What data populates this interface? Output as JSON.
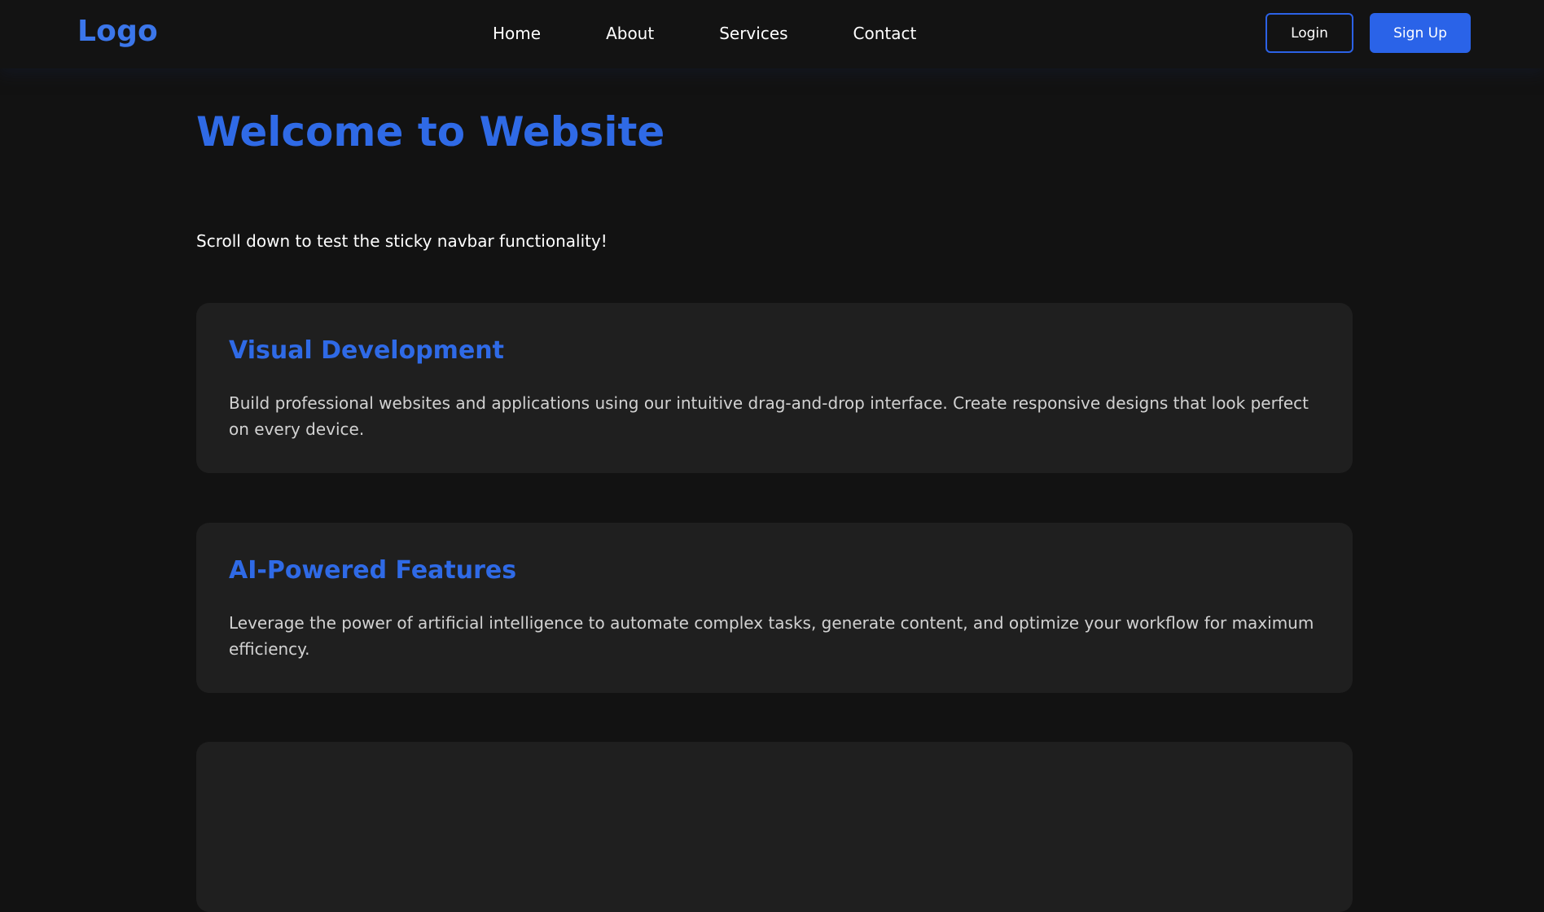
{
  "navbar": {
    "logo": "Logo",
    "links": [
      {
        "label": "Home"
      },
      {
        "label": "About"
      },
      {
        "label": "Services"
      },
      {
        "label": "Contact"
      }
    ],
    "login_label": "Login",
    "signup_label": "Sign Up"
  },
  "hero": {
    "title": "Welcome to Website",
    "subtitle": "Scroll down to test the sticky navbar functionality!"
  },
  "cards": [
    {
      "title": "Visual Development",
      "text": "Build professional websites and applications using our intuitive drag-and-drop interface. Create responsive designs that look perfect on every device."
    },
    {
      "title": "AI-Powered Features",
      "text": "Leverage the power of artificial intelligence to automate complex tasks, generate content, and optimize your workflow for maximum efficiency."
    }
  ],
  "colors": {
    "accent": "#2f6ae6",
    "background": "#121212",
    "card": "#1f1f1f"
  }
}
